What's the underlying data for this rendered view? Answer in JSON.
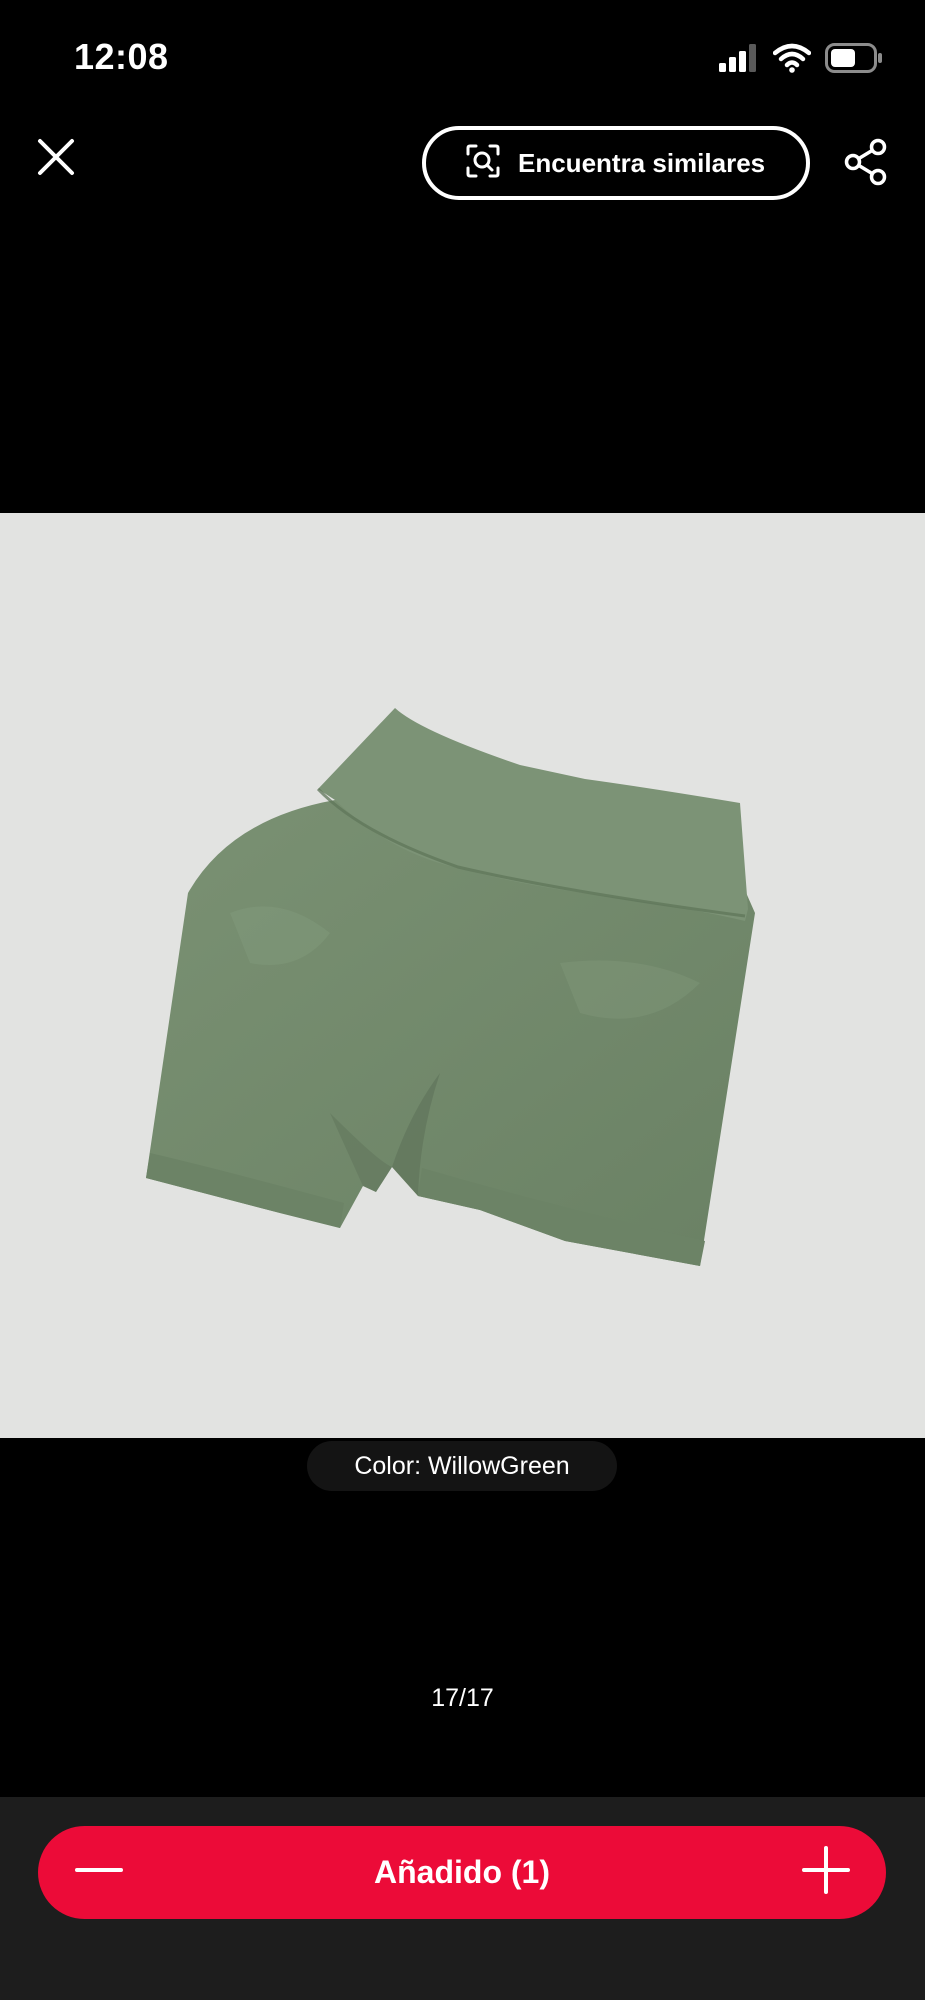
{
  "status_bar": {
    "time": "12:08",
    "icons": [
      "cellular-signal-icon",
      "wifi-icon",
      "battery-icon"
    ],
    "battery_level": 0.6
  },
  "top_bar": {
    "close_icon": "close-icon",
    "find_similar_label": "Encuentra similares",
    "find_similar_icon": "visual-search-icon",
    "share_icon": "share-icon"
  },
  "product": {
    "image_subject": "green shorts",
    "color_label": "Color: WillowGreen",
    "page_counter": "17/17"
  },
  "cart": {
    "minus_icon": "minus-icon",
    "label": "Añadido (1)",
    "plus_icon": "plus-icon",
    "accent_color": "#ec0b38"
  },
  "colors": {
    "background": "#000000",
    "image_background": "#e2e3e1",
    "bottom_bar": "#1d1d1d",
    "shorts_green": "#728a6c"
  }
}
